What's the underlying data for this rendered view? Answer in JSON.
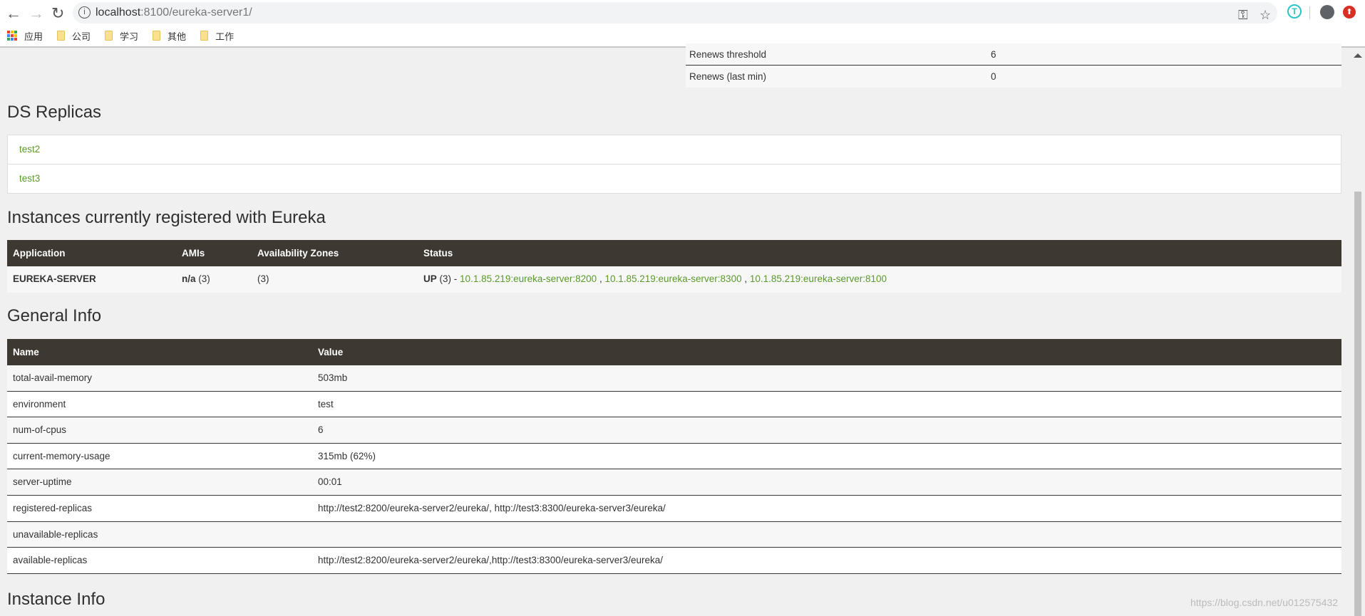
{
  "browser": {
    "url_host": "localhost",
    "url_path": ":8100/eureka-server1/",
    "bookmarks": [
      "应用",
      "公司",
      "学习",
      "其他",
      "工作"
    ]
  },
  "renews": [
    {
      "label": "Renews threshold",
      "value": "6"
    },
    {
      "label": "Renews (last min)",
      "value": "0"
    }
  ],
  "ds_replicas": {
    "title": "DS Replicas",
    "items": [
      "test2",
      "test3"
    ]
  },
  "instances": {
    "title": "Instances currently registered with Eureka",
    "headers": [
      "Application",
      "AMIs",
      "Availability Zones",
      "Status"
    ],
    "rows": [
      {
        "application": "EUREKA-SERVER",
        "amis_bold": "n/a",
        "amis_count": "(3)",
        "zones": "(3)",
        "status_bold": "UP",
        "status_count": "(3) -",
        "links": [
          "10.1.85.219:eureka-server:8200",
          "10.1.85.219:eureka-server:8300",
          "10.1.85.219:eureka-server:8100"
        ]
      }
    ]
  },
  "general_info": {
    "title": "General Info",
    "headers": [
      "Name",
      "Value"
    ],
    "rows": [
      {
        "name": "total-avail-memory",
        "value": "503mb"
      },
      {
        "name": "environment",
        "value": "test"
      },
      {
        "name": "num-of-cpus",
        "value": "6"
      },
      {
        "name": "current-memory-usage",
        "value": "315mb (62%)"
      },
      {
        "name": "server-uptime",
        "value": "00:01"
      },
      {
        "name": "registered-replicas",
        "value": "http://test2:8200/eureka-server2/eureka/, http://test3:8300/eureka-server3/eureka/"
      },
      {
        "name": "unavailable-replicas",
        "value": ""
      },
      {
        "name": "available-replicas",
        "value": "http://test2:8200/eureka-server2/eureka/,http://test3:8300/eureka-server3/eureka/"
      }
    ]
  },
  "instance_info": {
    "title": "Instance Info"
  },
  "watermark": "https://blog.csdn.net/u012575432"
}
